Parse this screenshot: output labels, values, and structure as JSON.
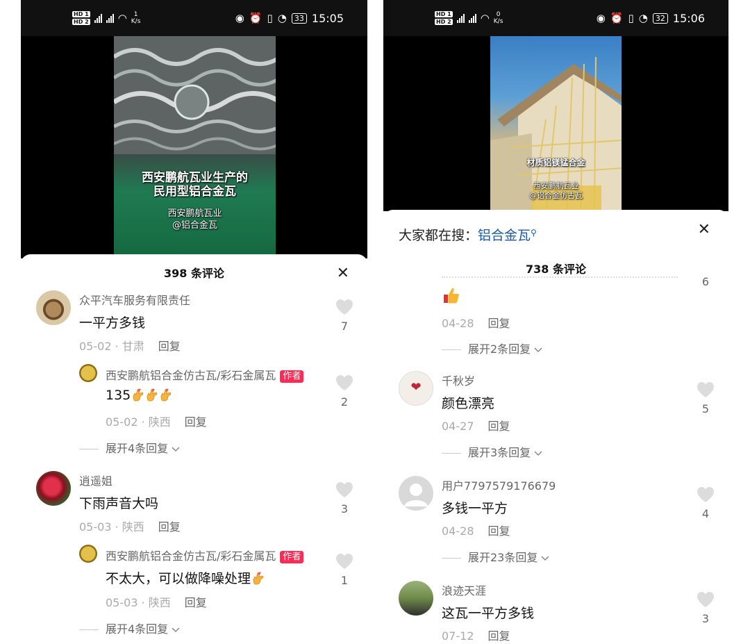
{
  "left": {
    "status": {
      "time": "15:05",
      "battery": "33",
      "speed_value": "1",
      "speed_unit": "K/s"
    },
    "video": {
      "caption_line1": "西安鹏航瓦业生产的",
      "caption_line2": "民用型铝合金瓦",
      "watermark_line1": "西安鹏航瓦业",
      "watermark_line2": "@铝合金瓦"
    },
    "comments_title": "398 条评论",
    "comments": [
      {
        "user": "众平汽车服务有限责任",
        "text": "一平方多钱",
        "date": "05-02",
        "location": "甘肃",
        "reply": "回复",
        "likes": "7"
      },
      {
        "user": "西安鹏航铝合金仿古瓦/彩石金属瓦",
        "badge": "作者",
        "text": "135",
        "date": "05-02",
        "location": "陕西",
        "reply": "回复",
        "likes": "2",
        "expand": "展开4条回复"
      },
      {
        "user": "逍遥姐",
        "text": "下雨声音大吗",
        "date": "05-03",
        "location": "陕西",
        "reply": "回复",
        "likes": "3"
      },
      {
        "user": "西安鹏航铝合金仿古瓦/彩石金属瓦",
        "badge": "作者",
        "text": "不太大，可以做降噪处理",
        "date": "05-03",
        "location": "陕西",
        "reply": "回复",
        "likes": "1",
        "expand": "展开4条回复"
      }
    ]
  },
  "right": {
    "status": {
      "time": "15:06",
      "battery": "32",
      "speed_value": "0",
      "speed_unit": "K/s"
    },
    "video": {
      "caption": "材质铝镁锰合金",
      "watermark_line1": "西安鹏航瓦业",
      "watermark_line2": "@铝合金仿古瓦"
    },
    "search_prefix": "大家都在搜：",
    "search_keyword": "铝合金瓦",
    "comments_title": "738 条评论",
    "partial": {
      "likes": "6",
      "date": "04-28",
      "reply": "回复",
      "expand": "展开2条回复"
    },
    "comments": [
      {
        "user": "千秋岁",
        "text": "颜色漂亮",
        "date": "04-27",
        "reply": "回复",
        "likes": "5",
        "expand": "展开3条回复"
      },
      {
        "user": "用户7797579176679",
        "text": "多钱一平方",
        "date": "04-28",
        "reply": "回复",
        "likes": "4",
        "expand": "展开23条回复"
      },
      {
        "user": "浪迹天涯",
        "text": "这瓦一平方多钱",
        "date": "07-12",
        "reply": "回复",
        "likes": "3"
      }
    ]
  },
  "icons": {
    "like": "heart-icon",
    "close": "close-icon",
    "expand": "chevron-down-icon",
    "search": "search-icon"
  },
  "colors": {
    "author_badge": "#fe2c55",
    "search_keyword": "#1a5aa6",
    "statusbar": "#111111"
  }
}
